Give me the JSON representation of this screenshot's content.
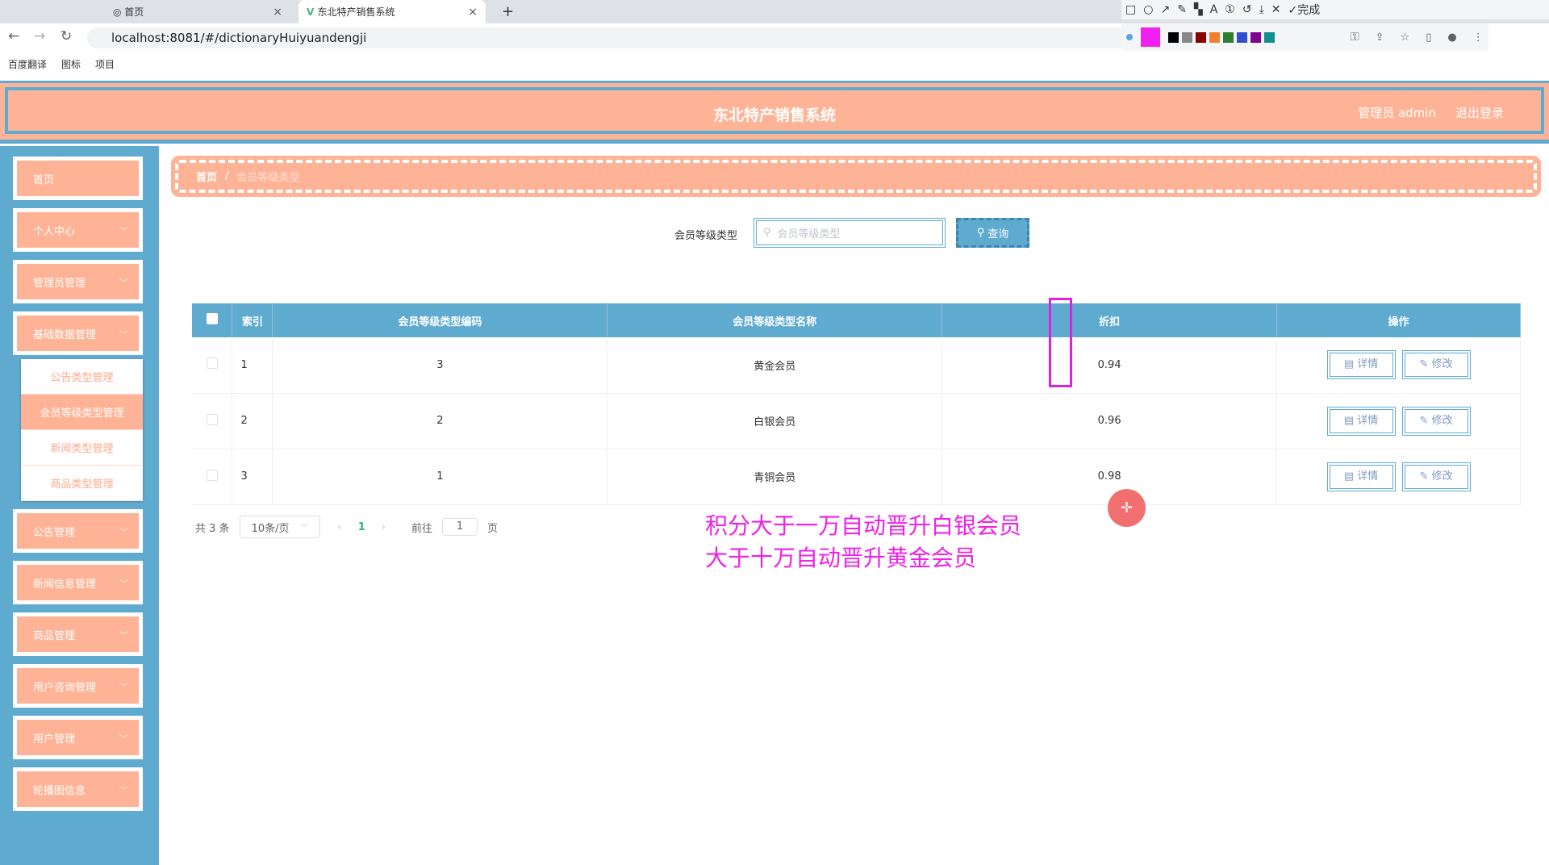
{
  "browser": {
    "tabs": [
      {
        "label": "首页"
      },
      {
        "label": "东北特产销售系统"
      }
    ],
    "url": "localhost:8081/#/dictionaryHuiyuandengji",
    "bookmarks": [
      "百度翻译",
      "图标",
      "项目"
    ],
    "toolbar_done": "完成",
    "new_tab": "+"
  },
  "colors": {
    "primary": "#5fabd0",
    "accent": "#ffb396",
    "annotation": "#f020e8"
  },
  "header": {
    "title": "东北特产销售系统",
    "user": "管理员 admin",
    "logout": "退出登录"
  },
  "sidebar": {
    "items": [
      {
        "label": "首页"
      },
      {
        "label": "个人中心"
      },
      {
        "label": "管理员管理"
      },
      {
        "label": "基础数据管理"
      },
      {
        "label": "公告管理"
      },
      {
        "label": "新闻信息管理"
      },
      {
        "label": "商品管理"
      },
      {
        "label": "用户咨询管理"
      },
      {
        "label": "用户管理"
      },
      {
        "label": "轮播图信息"
      }
    ],
    "submenu": [
      {
        "label": "公告类型管理"
      },
      {
        "label": "会员等级类型管理"
      },
      {
        "label": "新闻类型管理"
      },
      {
        "label": "商品类型管理"
      }
    ]
  },
  "breadcrumb": {
    "home": "首页",
    "sep": "/",
    "current": "会员等级类型"
  },
  "search": {
    "label": "会员等级类型",
    "placeholder": "会员等级类型",
    "button": "查询"
  },
  "table": {
    "headers": [
      "索引",
      "会员等级类型编码",
      "会员等级类型名称",
      "折扣",
      "操作"
    ],
    "rows": [
      {
        "index": "1",
        "code": "3",
        "name": "黄金会员",
        "discount": "0.94"
      },
      {
        "index": "2",
        "code": "2",
        "name": "白银会员",
        "discount": "0.96"
      },
      {
        "index": "3",
        "code": "1",
        "name": "青铜会员",
        "discount": "0.98"
      }
    ],
    "detail": "详情",
    "edit": "修改"
  },
  "pagination": {
    "total": "共 3 条",
    "page_size": "10条/页",
    "current": "1",
    "goto": "前往",
    "goto_value": "1",
    "page_suffix": "页"
  },
  "annotation": {
    "line1": "积分大于一万自动晋升白银会员",
    "line2": "大于十万自动晋升黄金会员"
  }
}
